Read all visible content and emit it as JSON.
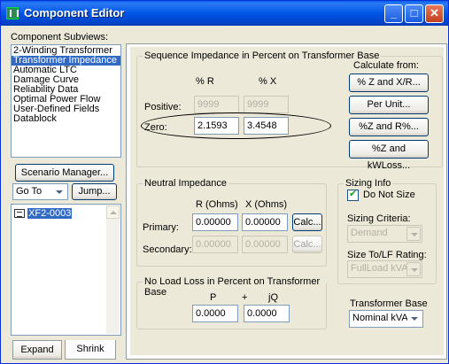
{
  "window": {
    "title": "Component Editor"
  },
  "sidebar": {
    "subviews_label": "Component Subviews:",
    "items": [
      {
        "label": "2-Winding Transformer",
        "selected": false
      },
      {
        "label": "Transformer Impedance",
        "selected": true
      },
      {
        "label": "Automatic LTC",
        "selected": false
      },
      {
        "label": "Damage Curve",
        "selected": false
      },
      {
        "label": "Reliability Data",
        "selected": false
      },
      {
        "label": "Optimal Power Flow",
        "selected": false
      },
      {
        "label": "User-Defined Fields",
        "selected": false
      },
      {
        "label": "Datablock",
        "selected": false
      }
    ],
    "scenario_button": "Scenario Manager...",
    "goto_value": "Go To",
    "jump_button": "Jump...",
    "tree_item": "XF2-0003",
    "expand_tab": "Expand",
    "shrink_tab": "Shrink"
  },
  "sequence": {
    "title": "Sequence Impedance in Percent on Transformer Base",
    "col_r": "% R",
    "col_x": "% X",
    "positive_label": "Positive:",
    "positive_r": "9999",
    "positive_x": "9999",
    "zero_label": "Zero:",
    "zero_r": "2.1593",
    "zero_x": "3.4548",
    "calc_from_label": "Calculate from:",
    "btn_z_xr": "% Z and X/R...",
    "btn_per_unit": "Per Unit...",
    "btn_z_r": "%Z and R%...",
    "btn_z_kwloss": "%Z and kWLoss..."
  },
  "neutral": {
    "title": "Neutral Impedance",
    "col_r": "R (Ohms)",
    "col_x": "X (Ohms)",
    "primary_label": "Primary:",
    "primary_r": "0.00000",
    "primary_x": "0.00000",
    "secondary_label": "Secondary:",
    "secondary_r": "0.00000",
    "secondary_x": "0.00000",
    "calc_label": "Calc..."
  },
  "sizing": {
    "title": "Sizing Info",
    "do_not_size_label": "Do Not Size",
    "criteria_label": "Sizing Criteria:",
    "criteria_value": "Demand",
    "ratio_label": "Size To/LF Rating:",
    "ratio_value": "FullLoad kVA"
  },
  "noload": {
    "title": "No Load Loss in Percent on Transformer Base",
    "p_label": "P",
    "plus": "+",
    "q_label": "jQ",
    "p_value": "0.0000",
    "q_value": "0.0000"
  },
  "base": {
    "label": "Transformer Base",
    "value": "Nominal kVA"
  }
}
